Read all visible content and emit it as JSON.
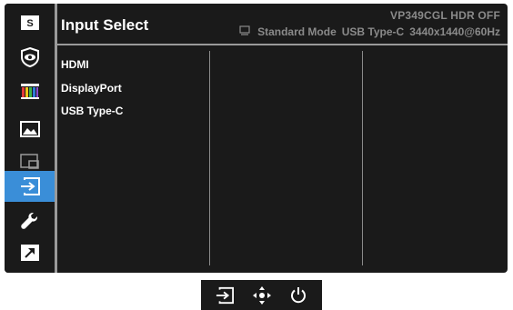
{
  "header": {
    "title": "Input Select",
    "model_info": "VP349CGL HDR OFF",
    "status": {
      "mode": "Standard Mode",
      "input": "USB Type-C",
      "resolution": "3440x1440@60Hz"
    }
  },
  "sidebar": {
    "items": [
      {
        "name": "splendid",
        "icon": "s-icon",
        "active": false
      },
      {
        "name": "eye-care",
        "icon": "eye-icon",
        "active": false
      },
      {
        "name": "color",
        "icon": "color-bars-icon",
        "active": false
      },
      {
        "name": "image",
        "icon": "landscape-icon",
        "active": false
      },
      {
        "name": "pip-pbp",
        "icon": "pip-icon",
        "active": false
      },
      {
        "name": "input-select",
        "icon": "input-icon",
        "active": true
      },
      {
        "name": "system-setup",
        "icon": "wrench-icon",
        "active": false
      },
      {
        "name": "shortcut",
        "icon": "shortcut-arrow-icon",
        "active": false
      }
    ]
  },
  "menu": {
    "options": [
      "HDMI",
      "DisplayPort",
      "USB Type-C"
    ]
  },
  "bottom_bar": {
    "buttons": [
      "input-icon",
      "joystick-icon",
      "power-icon"
    ]
  },
  "colors": {
    "accent": "#3a8ed8",
    "background": "#1a1a1a",
    "muted_text": "#8a8a8a"
  }
}
